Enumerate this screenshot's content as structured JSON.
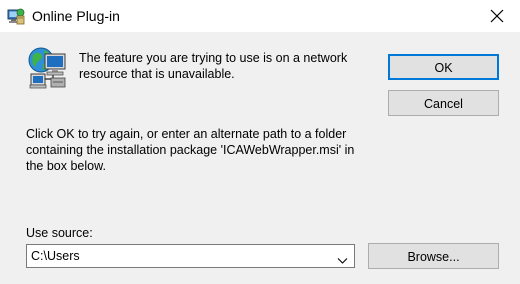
{
  "window": {
    "title": "Online Plug-in",
    "close_icon": "close-icon",
    "app_icon": "installer-icon"
  },
  "dialog": {
    "icon": "network-computer-icon",
    "message": "The feature you are trying to use is on a network resource that is unavailable.",
    "ok_label": "OK",
    "cancel_label": "Cancel",
    "instructions": "Click OK to try again, or enter an alternate path to a folder containing the installation package 'ICAWebWrapper.msi' in the box below.",
    "source_label": "Use source:",
    "source_value": "C:\\Users",
    "browse_label": "Browse..."
  },
  "colors": {
    "default_button_border": "#0078d7",
    "dialog_background": "#f0f0f0",
    "titlebar_background": "#ffffff"
  }
}
